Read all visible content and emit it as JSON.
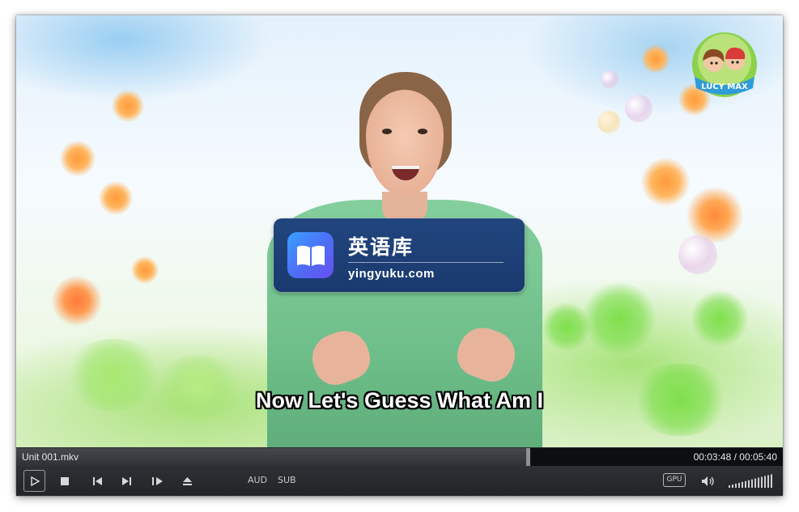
{
  "player": {
    "file_name": "Unit 001.mkv",
    "time_current": "00:03:48",
    "time_total": "00:05:40",
    "time_display": "00:03:48 / 00:05:40",
    "progress_fraction": 0.67,
    "volume_fraction": 1.0
  },
  "video": {
    "subtitle": "Now Let's Guess What Am I",
    "watermark_name": "英语库",
    "watermark_domain": "yingyuku.com",
    "channel_logo_text": "LUCY MAX"
  },
  "controls": {
    "play_icon": "play-icon",
    "stop_icon": "stop-icon",
    "prev_icon": "previous-icon",
    "next_icon": "next-icon",
    "frame_step_icon": "frame-step-icon",
    "eject_icon": "eject-icon",
    "audio_label": "AUD",
    "subtitle_label": "SUB",
    "gpu_label": "GPU",
    "speaker_icon": "speaker-icon"
  },
  "colors": {
    "badge_bg": "#1f4279",
    "control_bar": "#2a2c30",
    "seek_fill": "#3d4045",
    "subtitle_text": "#ffffff"
  }
}
